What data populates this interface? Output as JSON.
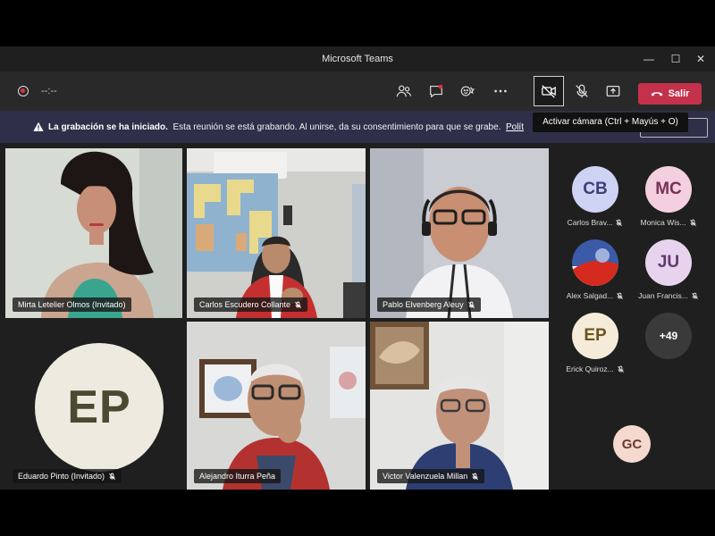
{
  "window": {
    "title": "Microsoft Teams",
    "controls": {
      "minimize": "—",
      "maximize": "☐",
      "close": "✕"
    }
  },
  "toolbar": {
    "timer": "--:--",
    "leave_label": "Salir",
    "icons": [
      "people-icon",
      "chat-icon",
      "reactions-icon",
      "more-icon",
      "camera-off-icon",
      "mic-off-icon",
      "share-icon"
    ],
    "leave_color": "#c4314b"
  },
  "banner": {
    "title": "La grabación se ha iniciado.",
    "message": "Esta reunión se está grabando. Al unirse, da su consentimiento para que se grabe.",
    "link": "Polít",
    "color": "#2f2f4a"
  },
  "tooltip": {
    "text": "Activar cámara (Ctrl + Mayús + O)"
  },
  "tiles": [
    {
      "name": "Mirta Letelier Olmos (Invitado)",
      "muted": false
    },
    {
      "name": "Carlos Escudero Collante",
      "muted": true
    },
    {
      "name": "Pablo Elvenberg Aleuy",
      "muted": true
    },
    {
      "name": "Eduardo Pinto (Invitado)",
      "muted": true,
      "initials": "EP"
    },
    {
      "name": "Alejandro Iturra Peña",
      "muted": false
    },
    {
      "name": "Victor Valenzuela Millan",
      "muted": true
    }
  ],
  "roster": [
    {
      "initials": "CB",
      "name": "Carlos Brav...",
      "color": "#cfd3f3"
    },
    {
      "initials": "MC",
      "name": "Monica Wis...",
      "color": "#f3cfe0"
    },
    {
      "initials": "",
      "name": "Alex Salgad...",
      "color": "#3b5aa8"
    },
    {
      "initials": "JU",
      "name": "Juan Francis...",
      "color": "#e7d3ee"
    },
    {
      "initials": "EP",
      "name": "Erick Quiroz...",
      "color": "#f4ecd8"
    },
    {
      "initials": "+49",
      "name": "",
      "color": "#3a3a3a"
    },
    {
      "initials": "GC",
      "name": "",
      "color": "#f5d9cf"
    }
  ],
  "accent": "#8b8cc7"
}
